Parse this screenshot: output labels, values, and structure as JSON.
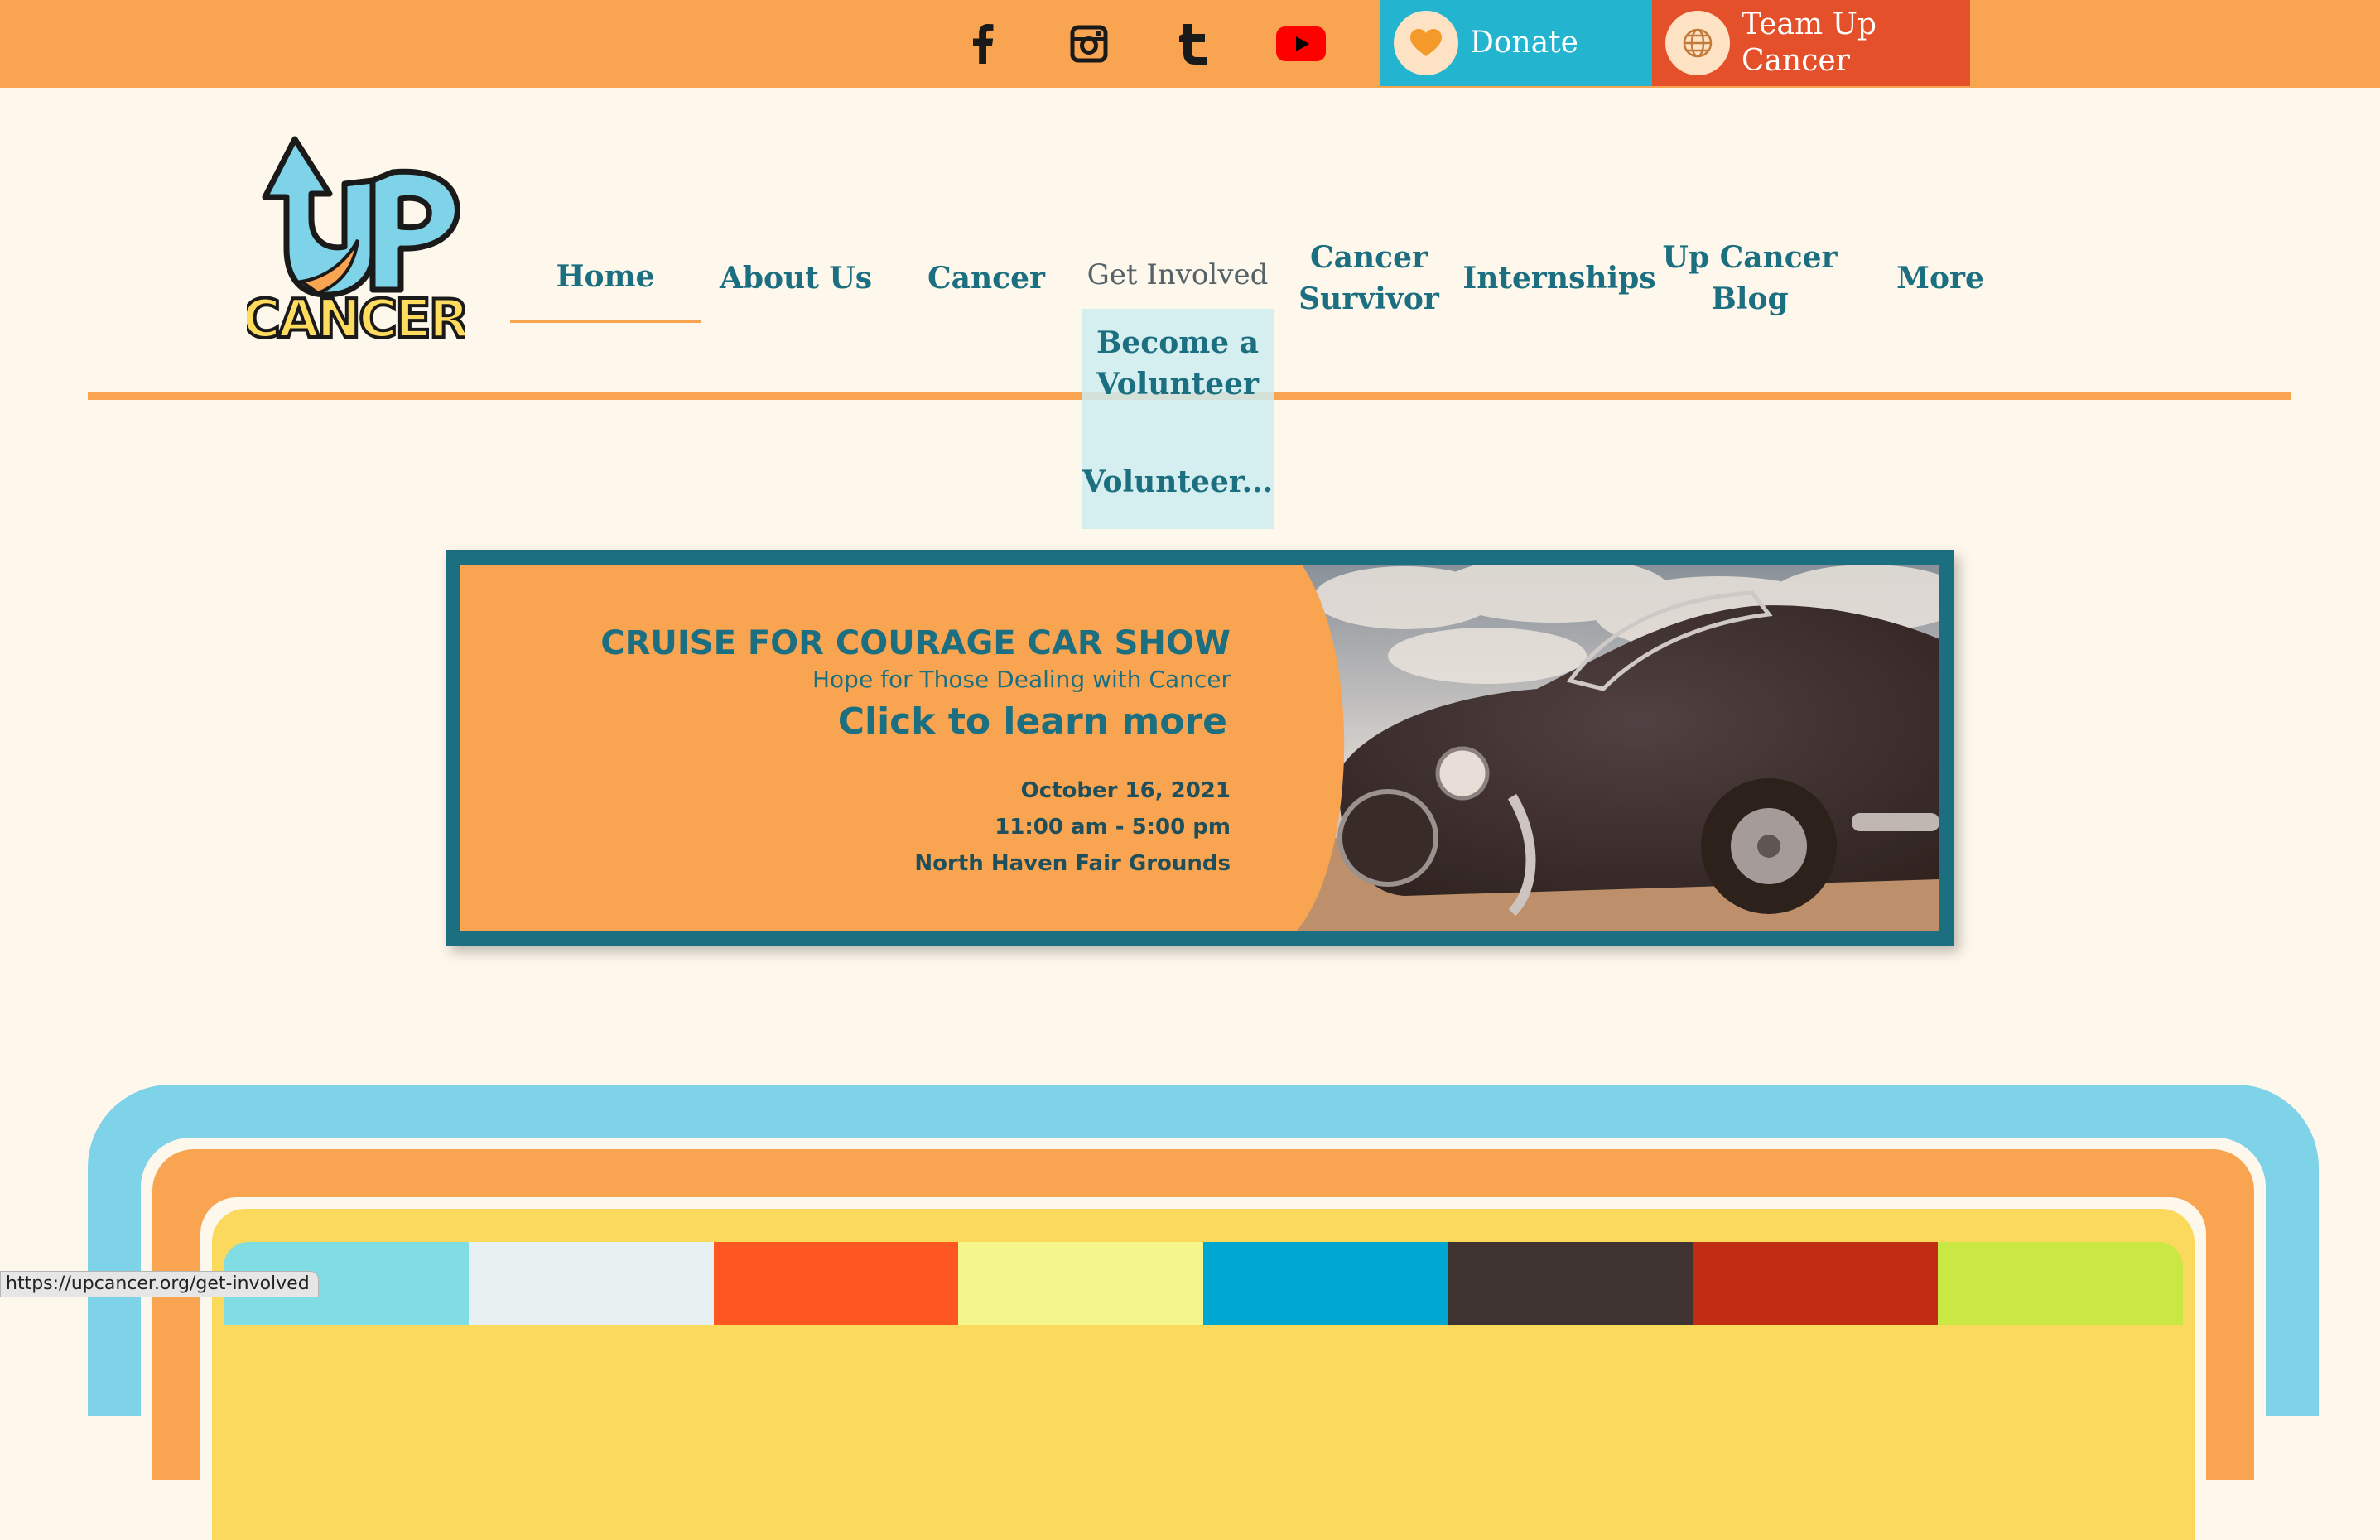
{
  "topbar": {
    "social": [
      {
        "name": "facebook-icon"
      },
      {
        "name": "instagram-icon"
      },
      {
        "name": "tumblr-icon"
      },
      {
        "name": "youtube-icon"
      }
    ],
    "donate_label": "Donate",
    "teamup_label_line1": "Team Up",
    "teamup_label_line2": "Cancer"
  },
  "logo": {
    "word1": "UP",
    "word2": "CANCER"
  },
  "nav": {
    "home": "Home",
    "about": "About Us",
    "cancer": "Cancer",
    "get_involved": "Get Involved",
    "survivor_line1": "Cancer",
    "survivor_line2": "Survivor",
    "internships": "Internships",
    "blog_line1": "Up Cancer",
    "blog_line2": "Blog",
    "more": "More"
  },
  "dropdown": {
    "item1_line1": "Become a",
    "item1_line2": "Volunteer",
    "item2": "Volunteer..."
  },
  "banner": {
    "title": "CRUISE FOR COURAGE CAR SHOW",
    "subtitle": "Hope for Those Dealing with Cancer",
    "cta": "Click to learn more",
    "date": "October 16, 2021",
    "time": "11:00 am - 5:00 pm",
    "location": "North Haven Fair Grounds"
  },
  "status_url": "https://upcancer.org/get-involved",
  "colors": {
    "topbar": "#f9a450",
    "donate": "#23b4cf",
    "teamup": "#e4502a",
    "nav_text": "#1b6f80",
    "background": "#fef8ec"
  }
}
